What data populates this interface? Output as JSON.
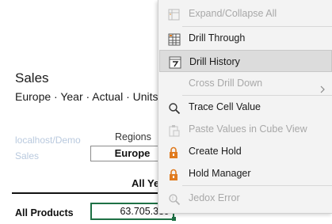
{
  "report": {
    "title": "Sales",
    "subtitle": "Europe · Year · Actual · Units",
    "connection": "localhost/Demo",
    "cube": "Sales",
    "regions_label": "Regions",
    "region_value": "Europe",
    "column_header": "All Years",
    "row_label": "All Products",
    "cell_value": "63.705.339"
  },
  "menu": {
    "items": [
      {
        "label": "Expand/Collapse All",
        "icon": "expand-collapse-icon",
        "enabled": false
      },
      {
        "label": "Drill Through",
        "icon": "drill-through-icon",
        "enabled": true
      },
      {
        "label": "Drill History",
        "icon": "drill-history-icon",
        "enabled": true,
        "highlighted": true
      },
      {
        "label": "Cross Drill Down",
        "icon": "",
        "enabled": false,
        "submenu": true
      },
      {
        "label": "Trace Cell Value",
        "icon": "magnifier-icon",
        "enabled": true
      },
      {
        "label": "Paste Values in Cube View",
        "icon": "paste-icon",
        "enabled": false
      },
      {
        "label": "Create Hold",
        "icon": "lock-icon",
        "enabled": true
      },
      {
        "label": "Hold Manager",
        "icon": "lock-icon",
        "enabled": true
      },
      {
        "label": "Jedox Error",
        "icon": "error-search-icon",
        "enabled": false
      }
    ]
  },
  "colors": {
    "accent_green": "#1e7145",
    "icon_orange": "#e07b1f",
    "disabled_text": "#a8a8a8"
  }
}
